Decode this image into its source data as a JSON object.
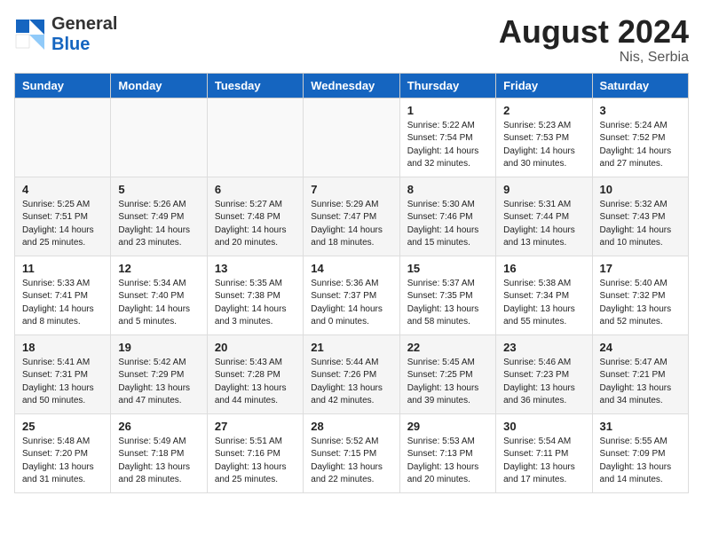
{
  "header": {
    "logo_general": "General",
    "logo_blue": "Blue",
    "month_year": "August 2024",
    "location": "Nis, Serbia"
  },
  "weekdays": [
    "Sunday",
    "Monday",
    "Tuesday",
    "Wednesday",
    "Thursday",
    "Friday",
    "Saturday"
  ],
  "weeks": [
    [
      {
        "day": "",
        "info": ""
      },
      {
        "day": "",
        "info": ""
      },
      {
        "day": "",
        "info": ""
      },
      {
        "day": "",
        "info": ""
      },
      {
        "day": "1",
        "info": "Sunrise: 5:22 AM\nSunset: 7:54 PM\nDaylight: 14 hours\nand 32 minutes."
      },
      {
        "day": "2",
        "info": "Sunrise: 5:23 AM\nSunset: 7:53 PM\nDaylight: 14 hours\nand 30 minutes."
      },
      {
        "day": "3",
        "info": "Sunrise: 5:24 AM\nSunset: 7:52 PM\nDaylight: 14 hours\nand 27 minutes."
      }
    ],
    [
      {
        "day": "4",
        "info": "Sunrise: 5:25 AM\nSunset: 7:51 PM\nDaylight: 14 hours\nand 25 minutes."
      },
      {
        "day": "5",
        "info": "Sunrise: 5:26 AM\nSunset: 7:49 PM\nDaylight: 14 hours\nand 23 minutes."
      },
      {
        "day": "6",
        "info": "Sunrise: 5:27 AM\nSunset: 7:48 PM\nDaylight: 14 hours\nand 20 minutes."
      },
      {
        "day": "7",
        "info": "Sunrise: 5:29 AM\nSunset: 7:47 PM\nDaylight: 14 hours\nand 18 minutes."
      },
      {
        "day": "8",
        "info": "Sunrise: 5:30 AM\nSunset: 7:46 PM\nDaylight: 14 hours\nand 15 minutes."
      },
      {
        "day": "9",
        "info": "Sunrise: 5:31 AM\nSunset: 7:44 PM\nDaylight: 14 hours\nand 13 minutes."
      },
      {
        "day": "10",
        "info": "Sunrise: 5:32 AM\nSunset: 7:43 PM\nDaylight: 14 hours\nand 10 minutes."
      }
    ],
    [
      {
        "day": "11",
        "info": "Sunrise: 5:33 AM\nSunset: 7:41 PM\nDaylight: 14 hours\nand 8 minutes."
      },
      {
        "day": "12",
        "info": "Sunrise: 5:34 AM\nSunset: 7:40 PM\nDaylight: 14 hours\nand 5 minutes."
      },
      {
        "day": "13",
        "info": "Sunrise: 5:35 AM\nSunset: 7:38 PM\nDaylight: 14 hours\nand 3 minutes."
      },
      {
        "day": "14",
        "info": "Sunrise: 5:36 AM\nSunset: 7:37 PM\nDaylight: 14 hours\nand 0 minutes."
      },
      {
        "day": "15",
        "info": "Sunrise: 5:37 AM\nSunset: 7:35 PM\nDaylight: 13 hours\nand 58 minutes."
      },
      {
        "day": "16",
        "info": "Sunrise: 5:38 AM\nSunset: 7:34 PM\nDaylight: 13 hours\nand 55 minutes."
      },
      {
        "day": "17",
        "info": "Sunrise: 5:40 AM\nSunset: 7:32 PM\nDaylight: 13 hours\nand 52 minutes."
      }
    ],
    [
      {
        "day": "18",
        "info": "Sunrise: 5:41 AM\nSunset: 7:31 PM\nDaylight: 13 hours\nand 50 minutes."
      },
      {
        "day": "19",
        "info": "Sunrise: 5:42 AM\nSunset: 7:29 PM\nDaylight: 13 hours\nand 47 minutes."
      },
      {
        "day": "20",
        "info": "Sunrise: 5:43 AM\nSunset: 7:28 PM\nDaylight: 13 hours\nand 44 minutes."
      },
      {
        "day": "21",
        "info": "Sunrise: 5:44 AM\nSunset: 7:26 PM\nDaylight: 13 hours\nand 42 minutes."
      },
      {
        "day": "22",
        "info": "Sunrise: 5:45 AM\nSunset: 7:25 PM\nDaylight: 13 hours\nand 39 minutes."
      },
      {
        "day": "23",
        "info": "Sunrise: 5:46 AM\nSunset: 7:23 PM\nDaylight: 13 hours\nand 36 minutes."
      },
      {
        "day": "24",
        "info": "Sunrise: 5:47 AM\nSunset: 7:21 PM\nDaylight: 13 hours\nand 34 minutes."
      }
    ],
    [
      {
        "day": "25",
        "info": "Sunrise: 5:48 AM\nSunset: 7:20 PM\nDaylight: 13 hours\nand 31 minutes."
      },
      {
        "day": "26",
        "info": "Sunrise: 5:49 AM\nSunset: 7:18 PM\nDaylight: 13 hours\nand 28 minutes."
      },
      {
        "day": "27",
        "info": "Sunrise: 5:51 AM\nSunset: 7:16 PM\nDaylight: 13 hours\nand 25 minutes."
      },
      {
        "day": "28",
        "info": "Sunrise: 5:52 AM\nSunset: 7:15 PM\nDaylight: 13 hours\nand 22 minutes."
      },
      {
        "day": "29",
        "info": "Sunrise: 5:53 AM\nSunset: 7:13 PM\nDaylight: 13 hours\nand 20 minutes."
      },
      {
        "day": "30",
        "info": "Sunrise: 5:54 AM\nSunset: 7:11 PM\nDaylight: 13 hours\nand 17 minutes."
      },
      {
        "day": "31",
        "info": "Sunrise: 5:55 AM\nSunset: 7:09 PM\nDaylight: 13 hours\nand 14 minutes."
      }
    ]
  ]
}
